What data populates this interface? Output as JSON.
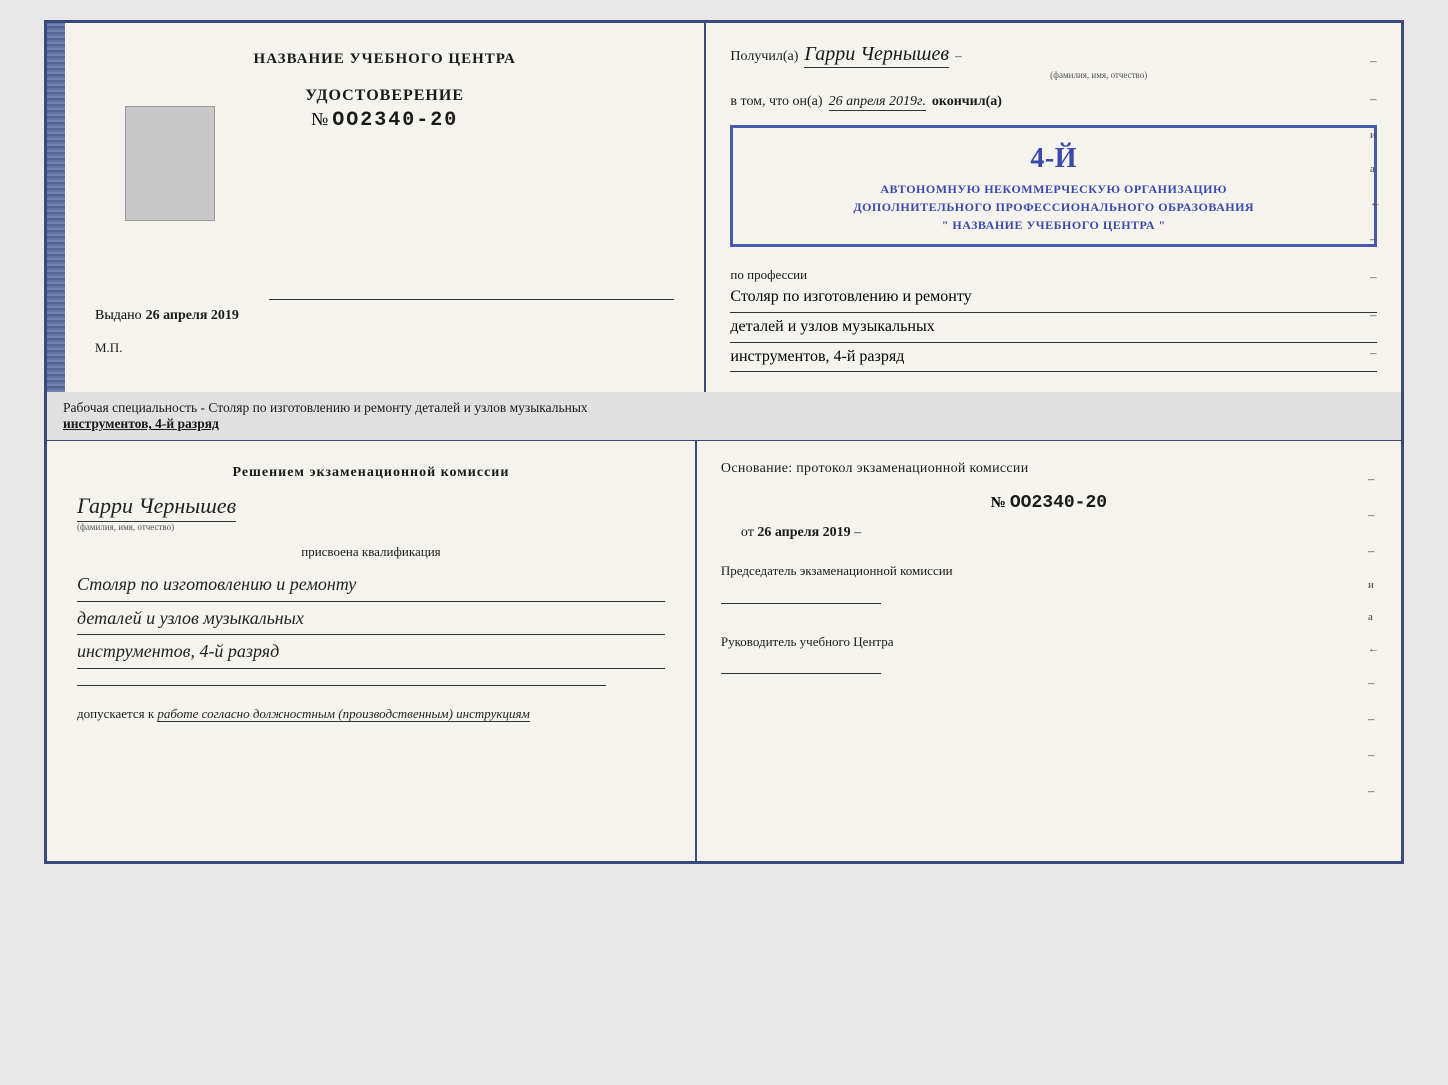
{
  "page": {
    "background": "#e8e8e8"
  },
  "top_cert": {
    "left": {
      "title": "НАЗВАНИЕ УЧЕБНОГО ЦЕНТРА",
      "cert_label": "УДОСТОВЕРЕНИЕ",
      "cert_number_prefix": "№",
      "cert_number": "OO2340-20",
      "issued_prefix": "Выдано",
      "issued_date": "26 апреля 2019",
      "mp_label": "М.П."
    },
    "right": {
      "recipient_prefix": "Получил(а)",
      "recipient_name": "Гарри Чернышев",
      "recipient_subtitle": "(фамилия, имя, отчество)",
      "in_that_prefix": "в том, что он(а)",
      "completion_date": "26 апреля 2019г.",
      "completed_label": "окончил(а)",
      "stamp_line1": "АВТОНОМНУЮ НЕКОММЕРЧЕСКУЮ ОРГАНИЗАЦИЮ",
      "stamp_line2": "ДОПОЛНИТЕЛЬНОГО ПРОФЕССИОНАЛЬНОГО ОБРАЗОВАНИЯ",
      "stamp_line3": "\" НАЗВАНИЕ УЧЕБНОГО ЦЕНТРА \"",
      "stamp_number": "4-й",
      "profession_prefix": "по профессии",
      "profession_line1": "Столяр по изготовлению и ремонту",
      "profession_line2": "деталей и узлов музыкальных",
      "profession_line3": "инструментов, 4-й разряд"
    }
  },
  "separator": {
    "text_plain": "Рабочая специальность - Столяр по изготовлению и ремонту деталей и узлов музыкальных",
    "text_underlined": "инструментов, 4-й разряд"
  },
  "bottom_cert": {
    "left": {
      "decision_text": "Решением  экзаменационной  комиссии",
      "name": "Гарри Чернышев",
      "name_subtitle": "(фамилия, имя, отчество)",
      "assigned_prefix": "присвоена квалификация",
      "qualification_line1": "Столяр по изготовлению и ремонту",
      "qualification_line2": "деталей и узлов музыкальных",
      "qualification_line3": "инструментов, 4-й разряд",
      "admitted_prefix": "допускается к",
      "admitted_text": "работе согласно должностным (производственным) инструкциям"
    },
    "right": {
      "basis_text": "Основание: протокол экзаменационной  комиссии",
      "protocol_prefix": "№",
      "protocol_number": "OO2340-20",
      "from_prefix": "от",
      "from_date": "26 апреля 2019",
      "chairman_title": "Председатель экзаменационной комиссии",
      "head_title": "Руководитель учебного Центра"
    }
  },
  "dashes": {
    "right_side": [
      "–",
      "–",
      "и",
      "а",
      "←",
      "–",
      "–",
      "–",
      "–"
    ]
  }
}
